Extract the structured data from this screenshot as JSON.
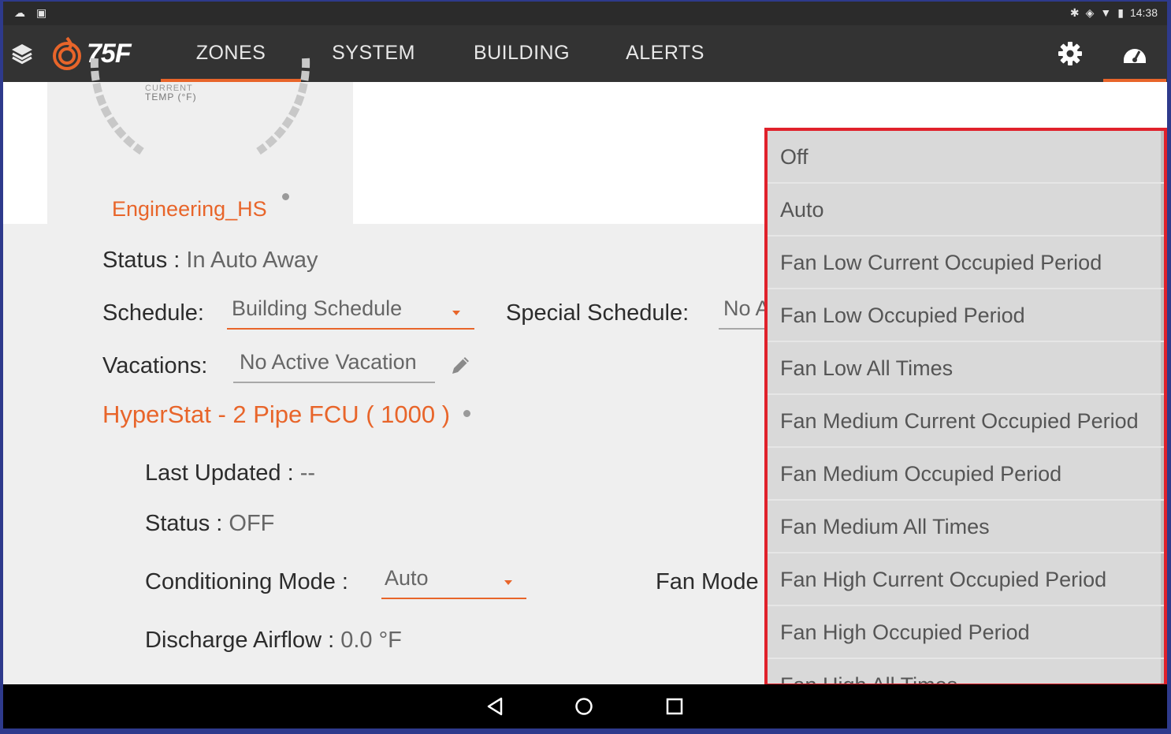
{
  "statusbar": {
    "left_icons": [
      "cloud-icon",
      "clipboard-icon"
    ],
    "right_icons": [
      "bluetooth-icon",
      "vibrate-icon",
      "wifi-icon",
      "battery-icon"
    ],
    "time": "14:38"
  },
  "nav": {
    "logo_text": "75F",
    "tabs": [
      {
        "label": "ZONES",
        "active": true
      },
      {
        "label": "SYSTEM",
        "active": false
      },
      {
        "label": "BUILDING",
        "active": false
      },
      {
        "label": "ALERTS",
        "active": false
      }
    ],
    "accent_color": "#e8652a"
  },
  "zone": {
    "temp_label_top": "CURRENT",
    "temp_label": "TEMP (°F)",
    "name": "Engineering_HS"
  },
  "details": {
    "status_label": "Status :",
    "status_value": "In Auto Away",
    "schedule_label": "Schedule:",
    "schedule_value": "Building Schedule",
    "special_schedule_label": "Special Schedule:",
    "special_schedule_value": "No A",
    "vacations_label": "Vacations:",
    "vacations_value": "No Active Vacation",
    "device_title": "HyperStat -  2 Pipe FCU ( 1000 )",
    "last_updated_label": "Last Updated :",
    "last_updated_value": "--",
    "device_status_label": "Status :",
    "device_status_value": "OFF",
    "conditioning_label": "Conditioning Mode :",
    "conditioning_value": "Auto",
    "fan_mode_label": "Fan Mode",
    "discharge_label": "Discharge Airflow :",
    "discharge_value": "0.0 °F"
  },
  "fan_mode_options": [
    "Off",
    "Auto",
    "Fan Low Current Occupied Period",
    "Fan Low Occupied Period",
    "Fan Low All Times",
    "Fan Medium Current Occupied Period",
    "Fan Medium Occupied Period",
    "Fan Medium All Times",
    "Fan High Current Occupied Period",
    "Fan High Occupied Period",
    "Fan High All Times"
  ]
}
